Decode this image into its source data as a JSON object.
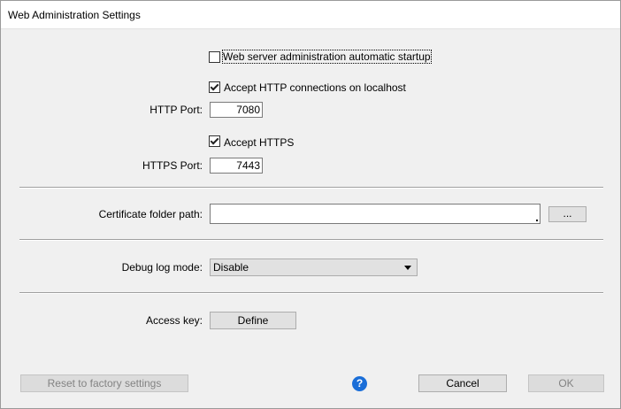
{
  "window": {
    "title": "Web Administration Settings"
  },
  "options": {
    "auto_startup": {
      "label": "Web server administration automatic startup",
      "checked": false
    },
    "http_localhost": {
      "label": "Accept HTTP connections on localhost",
      "checked": true
    },
    "http_port": {
      "label": "HTTP Port:",
      "value": "7080"
    },
    "https": {
      "label": "Accept HTTPS",
      "checked": true
    },
    "https_port": {
      "label": "HTTPS Port:",
      "value": "7443"
    }
  },
  "certificate": {
    "label": "Certificate folder path:",
    "value": "",
    "browse_label": "..."
  },
  "debug": {
    "label": "Debug log mode:",
    "selected": "Disable"
  },
  "access_key": {
    "label": "Access key:",
    "define_label": "Define"
  },
  "footer": {
    "reset_label": "Reset to factory settings",
    "help_icon_glyph": "?",
    "cancel_label": "Cancel",
    "ok_label": "OK"
  },
  "colors": {
    "help_icon": "#1a6ed8",
    "window_bg": "#f0f0f0",
    "titlebar_bg": "#ffffff"
  }
}
